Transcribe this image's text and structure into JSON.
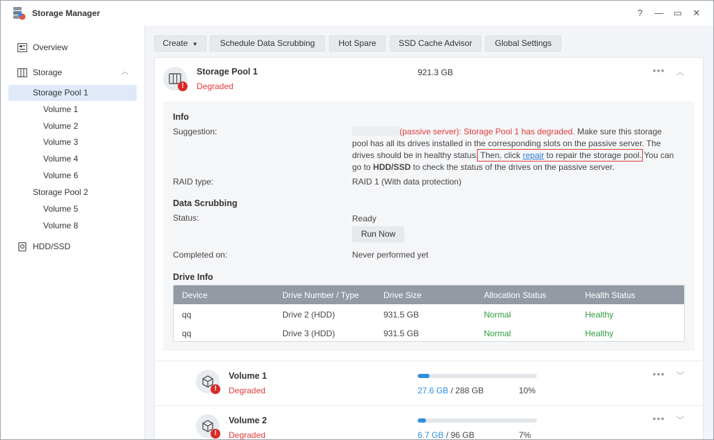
{
  "window": {
    "title": "Storage Manager",
    "controls": {
      "help": "?",
      "minimize": "—",
      "maximize": "▭",
      "close": "✕"
    }
  },
  "sidebar": {
    "overview": "Overview",
    "storage": "Storage",
    "items": [
      {
        "label": "Storage Pool 1",
        "selected": true
      },
      {
        "label": "Volume 1"
      },
      {
        "label": "Volume 2"
      },
      {
        "label": "Volume 3"
      },
      {
        "label": "Volume 4"
      },
      {
        "label": "Volume 6"
      },
      {
        "label": "Storage Pool 2"
      },
      {
        "label": "Volume 5"
      },
      {
        "label": "Volume 8"
      }
    ],
    "hdd": "HDD/SSD"
  },
  "toolbar": {
    "create": "Create",
    "scrubbing": "Schedule Data Scrubbing",
    "hotspare": "Hot Spare",
    "ssdcache": "SSD Cache Advisor",
    "global": "Global Settings"
  },
  "pool": {
    "name": "Storage Pool 1",
    "status": "Degraded",
    "size": "921.3 GB",
    "info_heading": "Info",
    "suggestion_label": "Suggestion:",
    "suggestion": {
      "red": "(passive server): Storage Pool 1 has degraded.",
      "part1": " Make sure this storage pool has all its drives installed in the corresponding slots on the passive server. The drives should be in healthy status.",
      "box_pre": " Then, click ",
      "link": "repair",
      "box_post": " to repair the storage pool.",
      "part2": " You can go to ",
      "bold": "HDD/SSD",
      "part3": " to check the status of the drives on the passive server."
    },
    "raid_label": "RAID type:",
    "raid_value": "RAID 1 (With data protection)",
    "scrub_heading": "Data Scrubbing",
    "status_label": "Status:",
    "status_value": "Ready",
    "run_now": "Run Now",
    "completed_label": "Completed on:",
    "completed_value": "Never performed yet",
    "drive_heading": "Drive Info",
    "drive_columns": [
      "Device",
      "Drive Number / Type",
      "Drive Size",
      "Allocation Status",
      "Health Status"
    ],
    "drives": [
      {
        "device": "qq",
        "number": "Drive 2 (HDD)",
        "size": "931.5 GB",
        "allocation": "Normal",
        "health": "Healthy"
      },
      {
        "device": "qq",
        "number": "Drive 3 (HDD)",
        "size": "931.5 GB",
        "allocation": "Normal",
        "health": "Healthy"
      }
    ]
  },
  "volumes": [
    {
      "name": "Volume 1",
      "status": "Degraded",
      "used": "27.6 GB",
      "total": " / 288 GB",
      "pct": "10%",
      "fill": 0.1
    },
    {
      "name": "Volume 2",
      "status": "Degraded",
      "used": "6.7 GB",
      "total": " / 96 GB",
      "pct": "7%",
      "fill": 0.07
    }
  ],
  "colors": {
    "accent": "#2d8fe0",
    "error": "#e03a3a",
    "ok": "#2e9b3e"
  }
}
